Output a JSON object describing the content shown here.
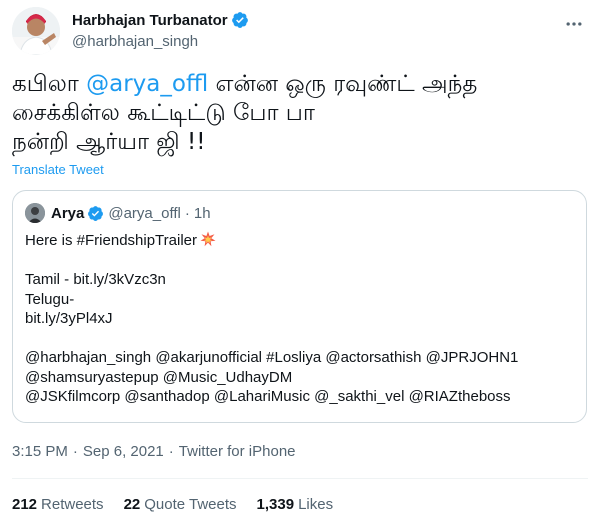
{
  "tweet": {
    "author": {
      "display_name": "Harbhajan Turbanator",
      "handle": "@harbhajan_singh",
      "verified": true,
      "verified_color": "#1d9bf0"
    },
    "text": {
      "line1_prefix": "கபிலா ",
      "line1_mention": "@arya_offl",
      "line1_suffix": " என்ன ஒரு ரவுண்ட் அந்த",
      "line2": "சைக்கிள்ல கூட்டிட்டு போ பா",
      "line3": "நன்றி ஆர்யா ஜி !!"
    },
    "translate_label": "Translate Tweet",
    "quoted": {
      "display_name": "Arya",
      "handle": "@arya_offl",
      "time": "1h",
      "dot": "·",
      "lines": [
        "Here is #FriendshipTrailer",
        "",
        "Tamil - bit.ly/3kVzc3n",
        "Telugu-",
        "bit.ly/3yPl4xJ",
        "",
        "@harbhajan_singh @akarjunofficial #Losliya @actorsathish @JPRJOHN1",
        "@shamsuryastepup @Music_UdhayDM",
        "@JSKfilmcorp @santhadop @LahariMusic  @_sakthi_vel @RIAZtheboss"
      ],
      "emoji_icon": "collision-icon"
    },
    "meta": {
      "time": "3:15 PM",
      "date": "Sep 6, 2021",
      "separator": "·",
      "source": "Twitter for iPhone"
    },
    "stats": {
      "retweets_count": "212",
      "retweets_label": "Retweets",
      "quotes_count": "22",
      "quotes_label": "Quote Tweets",
      "likes_count": "1,339",
      "likes_label": "Likes"
    },
    "colors": {
      "link": "#1d9bf0",
      "secondary_text": "#536471",
      "primary_text": "#0f1419",
      "border": "#cfd9de"
    }
  }
}
